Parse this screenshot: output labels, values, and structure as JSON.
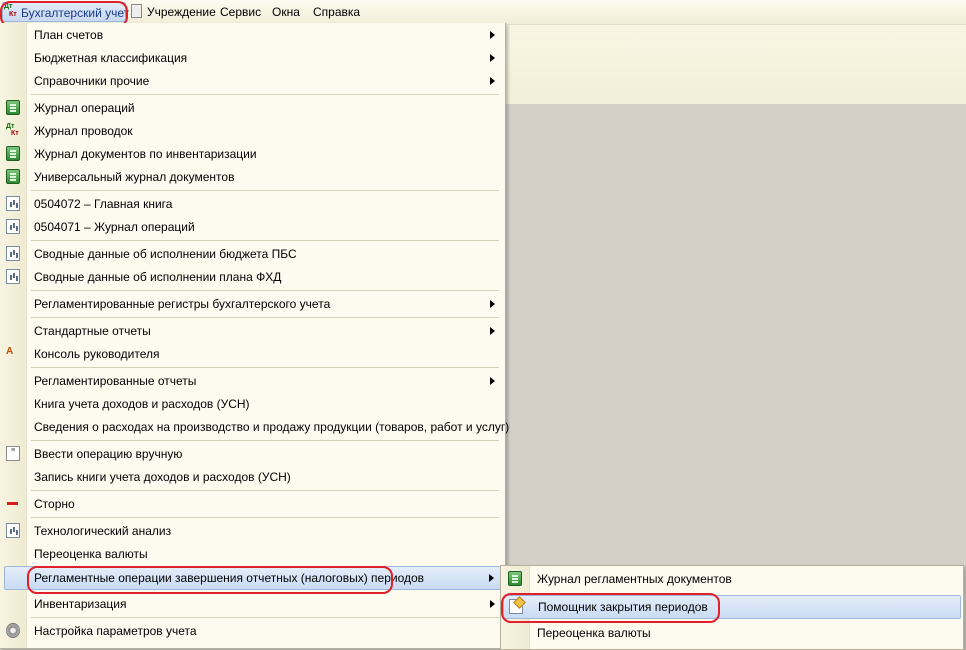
{
  "menubar": {
    "items": [
      {
        "label": "Бухгалтерский учет",
        "icon": "dt-kt-icon",
        "active": true
      },
      {
        "label": "Учреждение",
        "icon": "clipboard-icon"
      },
      {
        "label": "Сервис"
      },
      {
        "label": "Окна"
      },
      {
        "label": "Справка"
      }
    ],
    "dt_kt": {
      "dt": "Дт",
      "kt": "Кт"
    }
  },
  "menu": {
    "items": [
      {
        "label": "План счетов",
        "submenu": true
      },
      {
        "label": "Бюджетная классификация",
        "submenu": true
      },
      {
        "label": "Справочники прочие",
        "submenu": true
      },
      {
        "label": "Журнал операций",
        "icon": "journal-icon"
      },
      {
        "label": "Журнал проводок",
        "icon": "dt-kt-icon"
      },
      {
        "label": "Журнал документов по инвентаризации",
        "icon": "journal-icon"
      },
      {
        "label": "Универсальный журнал документов",
        "icon": "journal-icon"
      },
      {
        "label": "0504072  –  Главная книга",
        "icon": "report-icon"
      },
      {
        "label": "0504071  –  Журнал операций",
        "icon": "report-icon"
      },
      {
        "label": "Сводные данные об исполнении бюджета ПБС",
        "icon": "report-icon"
      },
      {
        "label": "Сводные данные об исполнении плана ФХД",
        "icon": "report-icon"
      },
      {
        "label": "Регламентированные регистры бухгалтерского учета",
        "submenu": true
      },
      {
        "label": "Стандартные отчеты",
        "submenu": true
      },
      {
        "label": "Консоль руководителя",
        "icon": "console-icon"
      },
      {
        "label": "Регламентированные отчеты",
        "submenu": true
      },
      {
        "label": "Книга учета доходов и расходов (УСН)"
      },
      {
        "label": "Сведения о расходах на производство и продажу продукции (товаров, работ и услуг)"
      },
      {
        "label": "Ввести операцию вручную",
        "icon": "manual-entry-icon"
      },
      {
        "label": "Запись книги учета доходов и расходов (УСН)"
      },
      {
        "label": "Сторно",
        "icon": "storno-icon"
      },
      {
        "label": "Технологический анализ",
        "icon": "report-icon"
      },
      {
        "label": "Переоценка валюты"
      },
      {
        "label": "Регламентные операции завершения отчетных (налоговых) периодов",
        "submenu": true,
        "highlighted": true
      },
      {
        "label": "Инвентаризация",
        "submenu": true
      },
      {
        "label": "Настройка параметров учета",
        "icon": "gear-icon"
      }
    ]
  },
  "submenu": {
    "items": [
      {
        "label": "Журнал регламентных документов",
        "icon": "journal-icon"
      },
      {
        "label": "Помощник закрытия периодов",
        "icon": "wizard-icon",
        "highlighted": true
      },
      {
        "label": "Переоценка валюты"
      }
    ]
  },
  "annotation_color": "#e0202a"
}
